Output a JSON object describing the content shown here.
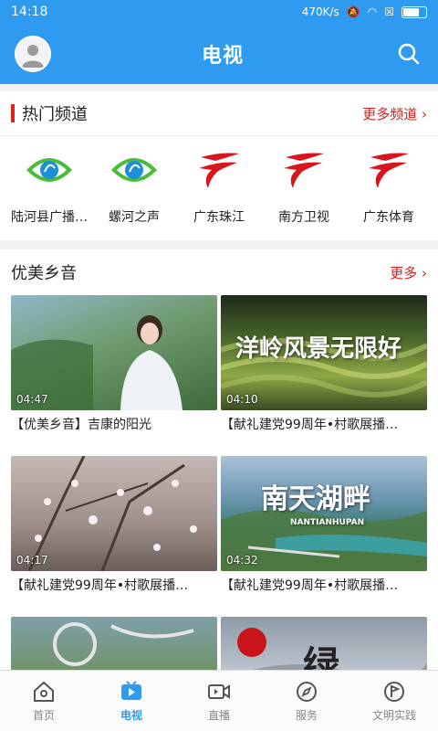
{
  "status": {
    "time": "14:18",
    "speed": "470K/s"
  },
  "header": {
    "title": "电视"
  },
  "hot_channels": {
    "title": "热门频道",
    "more": "更多频道 ›",
    "items": [
      {
        "label": "陆河县广播…",
        "icon": "eye-logo-icon"
      },
      {
        "label": "螺河之声",
        "icon": "eye-logo-icon"
      },
      {
        "label": "广东珠江",
        "icon": "gdtv-logo-icon"
      },
      {
        "label": "南方卫视",
        "icon": "gdtv-logo-icon"
      },
      {
        "label": "广东体育",
        "icon": "gdtv-logo-icon"
      }
    ]
  },
  "beautiful": {
    "title": "优美乡音",
    "more": "更多 ›",
    "videos": [
      {
        "title": "【优美乡音】吉康的阳光",
        "duration": "04:47"
      },
      {
        "title": "【献礼建党99周年•村歌展播…",
        "duration": "04:10",
        "overlay": "洋岭风景无限好"
      },
      {
        "title": "【献礼建党99周年•村歌展播…",
        "duration": "04:17"
      },
      {
        "title": "【献礼建党99周年•村歌展播…",
        "duration": "04:32",
        "overlay": "南天湖畔",
        "overlay_sub": "NANTIANHUPAN"
      },
      {
        "title": "",
        "duration": "",
        "overlay": ""
      },
      {
        "title": "",
        "duration": "",
        "overlay": "绿"
      }
    ]
  },
  "tabs": [
    {
      "label": "首页",
      "icon": "home-icon"
    },
    {
      "label": "电视",
      "icon": "tv-icon",
      "active": true
    },
    {
      "label": "直播",
      "icon": "live-icon"
    },
    {
      "label": "服务",
      "icon": "compass-icon"
    },
    {
      "label": "文明实践",
      "icon": "flag-icon"
    }
  ],
  "colors": {
    "primary": "#2e9bf0",
    "accent": "#d42020"
  }
}
